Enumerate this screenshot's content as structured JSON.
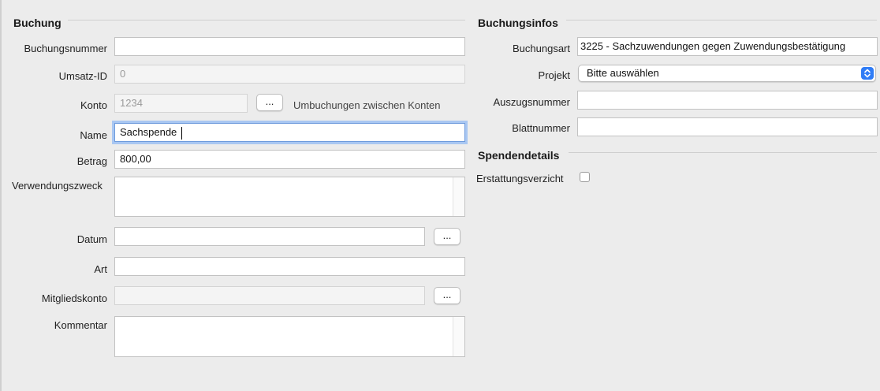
{
  "left": {
    "title": "Buchung",
    "fields": {
      "buchungsnummer": {
        "label": "Buchungsnummer",
        "value": ""
      },
      "umsatz_id": {
        "label": "Umsatz-ID",
        "value": "0"
      },
      "konto": {
        "label": "Konto",
        "value": "1234",
        "button": "...",
        "note": "Umbuchungen zwischen Konten"
      },
      "name": {
        "label": "Name",
        "value": "Sachspende"
      },
      "betrag": {
        "label": "Betrag",
        "value": "800,00"
      },
      "verwendungszweck": {
        "label": "Verwendungszweck",
        "value": ""
      },
      "datum": {
        "label": "Datum",
        "value": "",
        "button": "..."
      },
      "art": {
        "label": "Art",
        "value": ""
      },
      "mitgliedskonto": {
        "label": "Mitgliedskonto",
        "value": "",
        "button": "..."
      },
      "kommentar": {
        "label": "Kommentar",
        "value": ""
      }
    }
  },
  "right": {
    "title": "Buchungsinfos",
    "fields": {
      "buchungsart": {
        "label": "Buchungsart",
        "value": "3225 - Sachzuwendungen gegen Zuwendungsbestätigung"
      },
      "projekt": {
        "label": "Projekt",
        "value": "Bitte auswählen"
      },
      "auszugsnummer": {
        "label": "Auszugsnummer",
        "value": ""
      },
      "blattnummer": {
        "label": "Blattnummer",
        "value": ""
      }
    },
    "spenden": {
      "title": "Spendendetails",
      "erstattungsverzicht": {
        "label": "Erstattungsverzicht",
        "checked": false
      }
    }
  },
  "colors": {
    "background": "#ececec",
    "focus_ring": "#a9c7f2",
    "select_accent": "#2f7cf6"
  },
  "icons": {
    "select_arrows": "chevron-up-down-icon"
  }
}
